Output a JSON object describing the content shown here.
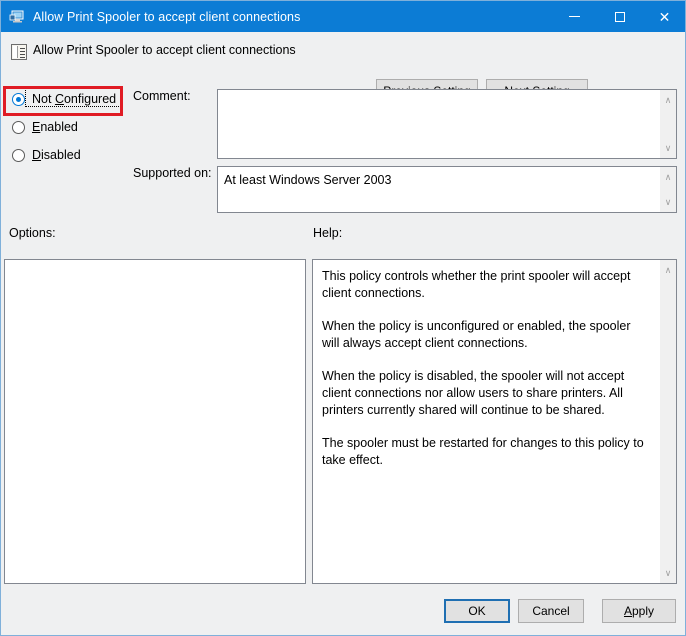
{
  "window": {
    "title": "Allow Print Spooler to accept client connections",
    "title_icon": "monitor-icon",
    "accent_color": "#0c7cd5",
    "background_color": "#eff0f1",
    "highlight_color": "#e01b24"
  },
  "caption": {
    "minimize_label": "─",
    "maximize_label": "□",
    "close_label": "✕"
  },
  "header": {
    "icon": "policy-setting-icon",
    "title": "Allow Print Spooler to accept client connections",
    "previous_setting": {
      "prefix": "P",
      "rest": "revious Setting"
    },
    "next_setting": {
      "prefix": "N",
      "rest": "ext Setting"
    }
  },
  "state_options": [
    {
      "id": "not-configured",
      "pre": "Not ",
      "accel": "C",
      "post": "onfigured",
      "selected": true,
      "focused": true,
      "highlighted": true
    },
    {
      "id": "enabled",
      "pre": "",
      "accel": "E",
      "post": "nabled",
      "selected": false,
      "focused": false,
      "highlighted": false
    },
    {
      "id": "disabled",
      "pre": "",
      "accel": "D",
      "post": "isabled",
      "selected": false,
      "focused": false,
      "highlighted": false
    }
  ],
  "fields": {
    "comment_label": "Comment:",
    "comment_value": "",
    "comment_placeholder": "",
    "supported_label": "Supported on:",
    "supported_value": "At least Windows Server 2003"
  },
  "panes": {
    "options_label": "Options:",
    "options_value": "",
    "help_label": "Help:",
    "help_paragraphs": [
      "This policy controls whether the print spooler will accept client connections.",
      "When the policy is unconfigured or enabled, the spooler will always accept client connections.",
      "When the policy is disabled, the spooler will not accept client connections nor allow users to share printers.  All printers currently shared will continue to be shared.",
      "The spooler must be restarted for changes to this policy to take effect."
    ]
  },
  "scrollbars": {
    "up_glyph": "∧",
    "down_glyph": "∨"
  },
  "footer": {
    "ok": "OK",
    "cancel": "Cancel",
    "apply": {
      "prefix": "A",
      "rest": "pply"
    }
  }
}
